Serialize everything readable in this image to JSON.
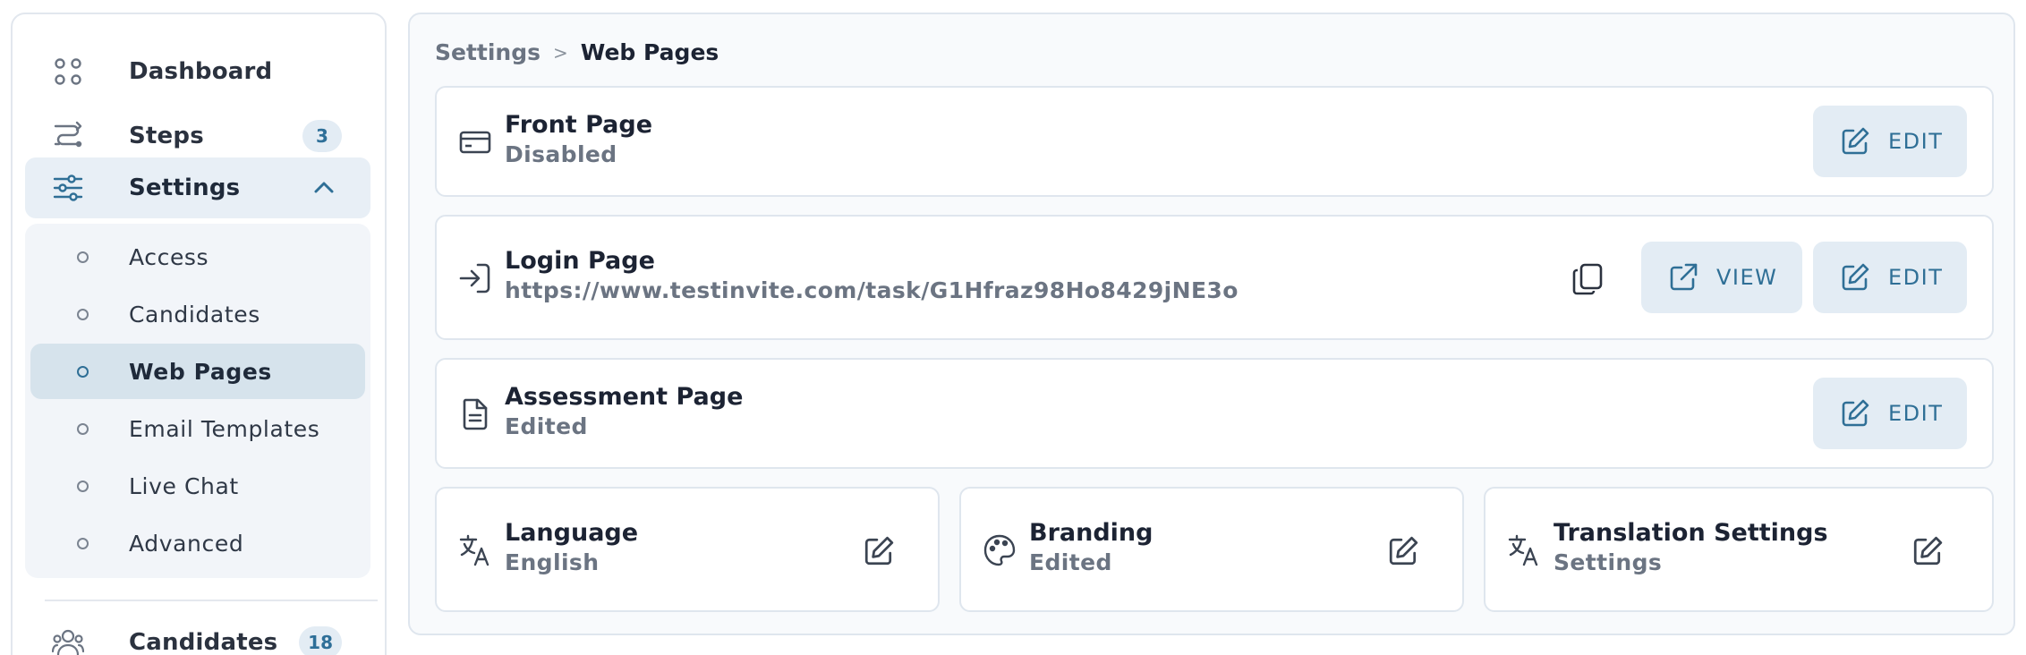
{
  "sidebar": {
    "items": [
      {
        "label": "Dashboard",
        "icon": "grid-dots-icon"
      },
      {
        "label": "Steps",
        "icon": "route-icon",
        "badge": "3"
      },
      {
        "label": "Settings",
        "icon": "sliders-icon",
        "expanded": true
      },
      {
        "label": "Candidates",
        "icon": "users-icon",
        "badge": "18"
      }
    ],
    "submenu": [
      {
        "label": "Access"
      },
      {
        "label": "Candidates"
      },
      {
        "label": "Web Pages",
        "current": true
      },
      {
        "label": "Email Templates"
      },
      {
        "label": "Live Chat"
      },
      {
        "label": "Advanced"
      }
    ]
  },
  "breadcrumb": {
    "parent": "Settings",
    "separator": ">",
    "current": "Web Pages"
  },
  "pages": {
    "front": {
      "title": "Front Page",
      "status": "Disabled",
      "icon": "credit-card-icon",
      "edit_label": "EDIT"
    },
    "login": {
      "title": "Login Page",
      "url": "https://www.testinvite.com/task/G1Hfraz98Ho8429jNE3o",
      "icon": "login-icon",
      "view_label": "VIEW",
      "edit_label": "EDIT"
    },
    "assessment": {
      "title": "Assessment Page",
      "status": "Edited",
      "icon": "file-text-icon",
      "edit_label": "EDIT"
    }
  },
  "tiles": {
    "language": {
      "title": "Language",
      "value": "English",
      "icon": "translate-icon"
    },
    "branding": {
      "title": "Branding",
      "value": "Edited",
      "icon": "palette-icon"
    },
    "translation": {
      "title": "Translation Settings",
      "value": "Settings",
      "icon": "translate-icon"
    }
  },
  "colors": {
    "accent": "#2f6f96",
    "button_bg": "#e3ecf4",
    "active_nav_bg": "#e8eff6",
    "current_sub_bg": "#d6e3ec",
    "text_muted": "#6b7482"
  }
}
